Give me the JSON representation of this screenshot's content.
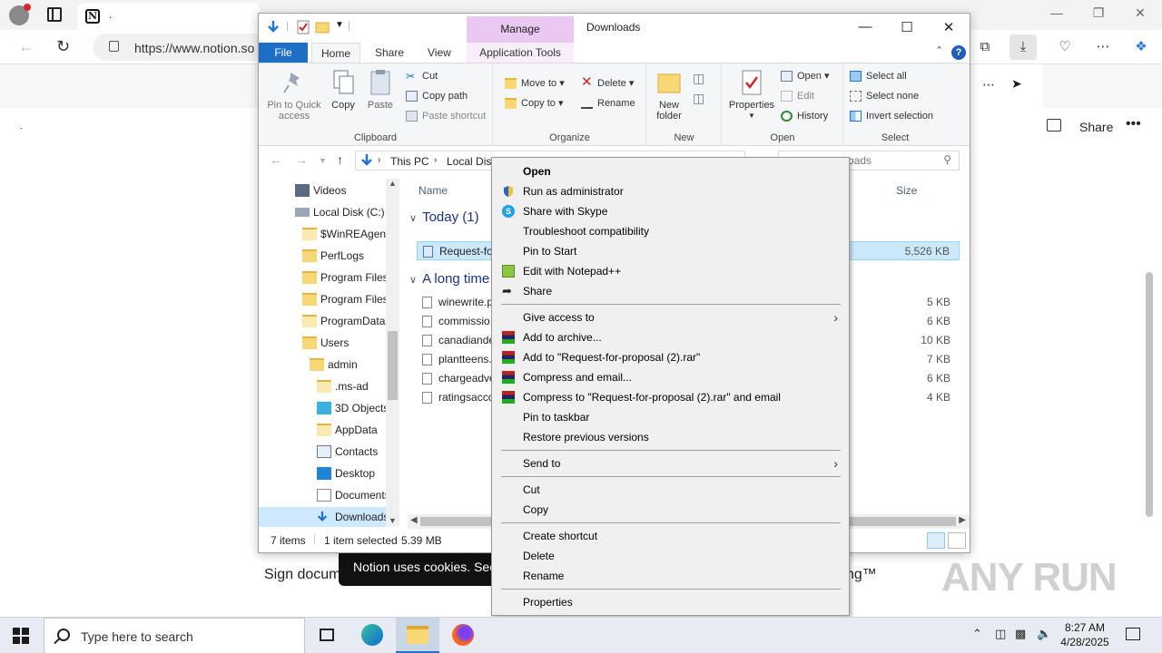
{
  "browser": {
    "url": "https://www.notion.so",
    "tab_title": "."
  },
  "notion": {
    "share_label": "Share",
    "more_label": "•••",
    "bg_text": "Sign docum",
    "bg_text_tail": "ng™",
    "cookie_text": "Notion uses cookies. See",
    "dot": "."
  },
  "watermark": "ANY RUN",
  "explorer": {
    "title": "Downloads",
    "manage_tab": "Manage",
    "menu": {
      "file": "File",
      "home": "Home",
      "share": "Share",
      "view": "View",
      "app_tools": "Application Tools"
    },
    "ribbon": {
      "clipboard": {
        "label": "Clipboard",
        "pin_quick_access": "Pin to Quick access",
        "copy": "Copy",
        "paste": "Paste",
        "cut": "Cut",
        "copy_path": "Copy path",
        "paste_shortcut": "Paste shortcut"
      },
      "organize": {
        "label": "Organize",
        "move_to": "Move to",
        "copy_to": "Copy to",
        "delete": "Delete",
        "rename": "Rename"
      },
      "new": {
        "label": "New",
        "new_folder": "New folder"
      },
      "open": {
        "label": "Open",
        "properties": "Properties",
        "open": "Open",
        "edit": "Edit",
        "history": "History"
      },
      "select": {
        "label": "Select",
        "select_all": "Select all",
        "select_none": "Select none",
        "invert_selection": "Invert selection"
      }
    },
    "address": {
      "crumb1": "This PC",
      "crumb2": "Local Disk",
      "search_placeholder": "oads"
    },
    "nav_items": [
      {
        "label": "Videos",
        "icon": "videos-icon"
      },
      {
        "label": "Local Disk (C:)",
        "icon": "drive-icon"
      },
      {
        "label": "$WinREAgent",
        "icon": "folder-icon"
      },
      {
        "label": "PerfLogs",
        "icon": "folder-icon"
      },
      {
        "label": "Program Files",
        "icon": "folder-icon"
      },
      {
        "label": "Program Files",
        "icon": "folder-icon"
      },
      {
        "label": "ProgramData",
        "icon": "folder-icon"
      },
      {
        "label": "Users",
        "icon": "folder-icon"
      },
      {
        "label": "admin",
        "icon": "folder-icon"
      },
      {
        "label": ".ms-ad",
        "icon": "folder-icon"
      },
      {
        "label": "3D Objects",
        "icon": "3d-objects-icon"
      },
      {
        "label": "AppData",
        "icon": "folder-icon"
      },
      {
        "label": "Contacts",
        "icon": "contacts-icon"
      },
      {
        "label": "Desktop",
        "icon": "desktop-icon"
      },
      {
        "label": "Documents",
        "icon": "documents-icon"
      },
      {
        "label": "Downloads",
        "icon": "downloads-icon"
      }
    ],
    "columns": {
      "name": "Name",
      "size": "Size"
    },
    "groups": {
      "today": "Today (1)",
      "long_ago": "A long time"
    },
    "files_today": [
      {
        "name": "Request-fo",
        "size": "5,526 KB"
      }
    ],
    "files_old": [
      {
        "name": "winewrite.p",
        "size": "5 KB"
      },
      {
        "name": "commissio",
        "size": "6 KB"
      },
      {
        "name": "canadiande",
        "size": "10 KB"
      },
      {
        "name": "plantteens.",
        "size": "7 KB"
      },
      {
        "name": "chargeadve",
        "size": "6 KB"
      },
      {
        "name": "ratingsacco",
        "size": "4 KB"
      }
    ],
    "status": {
      "items": "7 items",
      "selected": "1 item selected",
      "size": "5.39 MB"
    }
  },
  "context_menu": {
    "open": "Open",
    "run_as_admin": "Run as administrator",
    "share_skype": "Share with Skype",
    "troubleshoot": "Troubleshoot compatibility",
    "pin_start": "Pin to Start",
    "edit_npp": "Edit with Notepad++",
    "share": "Share",
    "give_access": "Give access to",
    "add_archive": "Add to archive...",
    "add_rar": "Add to \"Request-for-proposal (2).rar\"",
    "compress_email": "Compress and email...",
    "compress_rar_email": "Compress to \"Request-for-proposal (2).rar\" and email",
    "pin_taskbar": "Pin to taskbar",
    "restore_versions": "Restore previous versions",
    "send_to": "Send to",
    "cut": "Cut",
    "copy": "Copy",
    "create_shortcut": "Create shortcut",
    "delete": "Delete",
    "rename": "Rename",
    "properties": "Properties"
  },
  "taskbar": {
    "search_placeholder": "Type here to search",
    "time": "8:27 AM",
    "date": "4/28/2025"
  }
}
